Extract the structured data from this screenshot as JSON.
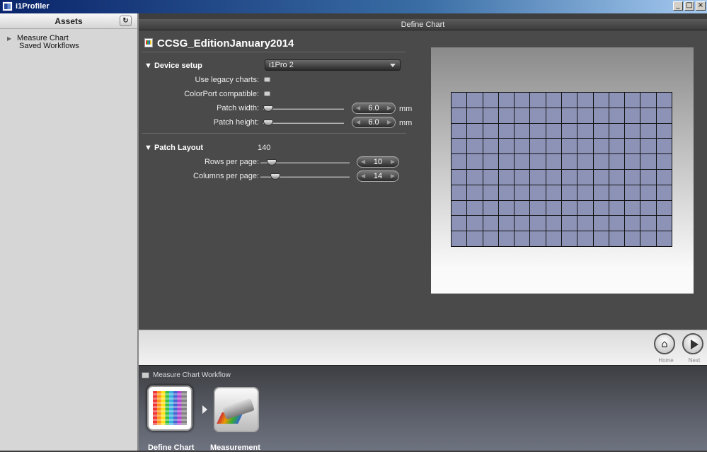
{
  "window": {
    "title": "i1Profiler",
    "buttons": [
      "_",
      "□",
      "×"
    ]
  },
  "assets": {
    "header": "Assets",
    "refresh_icon": "refresh-icon",
    "tree": [
      {
        "label": "Measure Chart",
        "children": [
          "Saved Workflows"
        ]
      }
    ]
  },
  "main": {
    "bar_title": "Define Chart",
    "doc_title": "CCSG_EditionJanuary2014",
    "device_setup": {
      "heading": "▼ Device setup",
      "device": "i1Pro 2",
      "legacy_label": "Use legacy charts:",
      "colorport_label": "ColorPort compatible:",
      "patch_width_label": "Patch width:",
      "patch_width": "6.0",
      "patch_height_label": "Patch height:",
      "patch_height": "6.0",
      "unit": "mm"
    },
    "patch_layout": {
      "heading": "▼ Patch Layout",
      "count": "140",
      "rows_label": "Rows per page:",
      "rows": "10",
      "cols_label": "Columns per page:",
      "cols": "14"
    },
    "preview": {
      "rows": 10,
      "cols": 14,
      "patch_color": "#8d93b7"
    }
  },
  "nav": {
    "home": "Home",
    "next": "Next"
  },
  "workflow": {
    "title": "Measure Chart Workflow",
    "steps": [
      "Define Chart",
      "Measurement"
    ]
  }
}
